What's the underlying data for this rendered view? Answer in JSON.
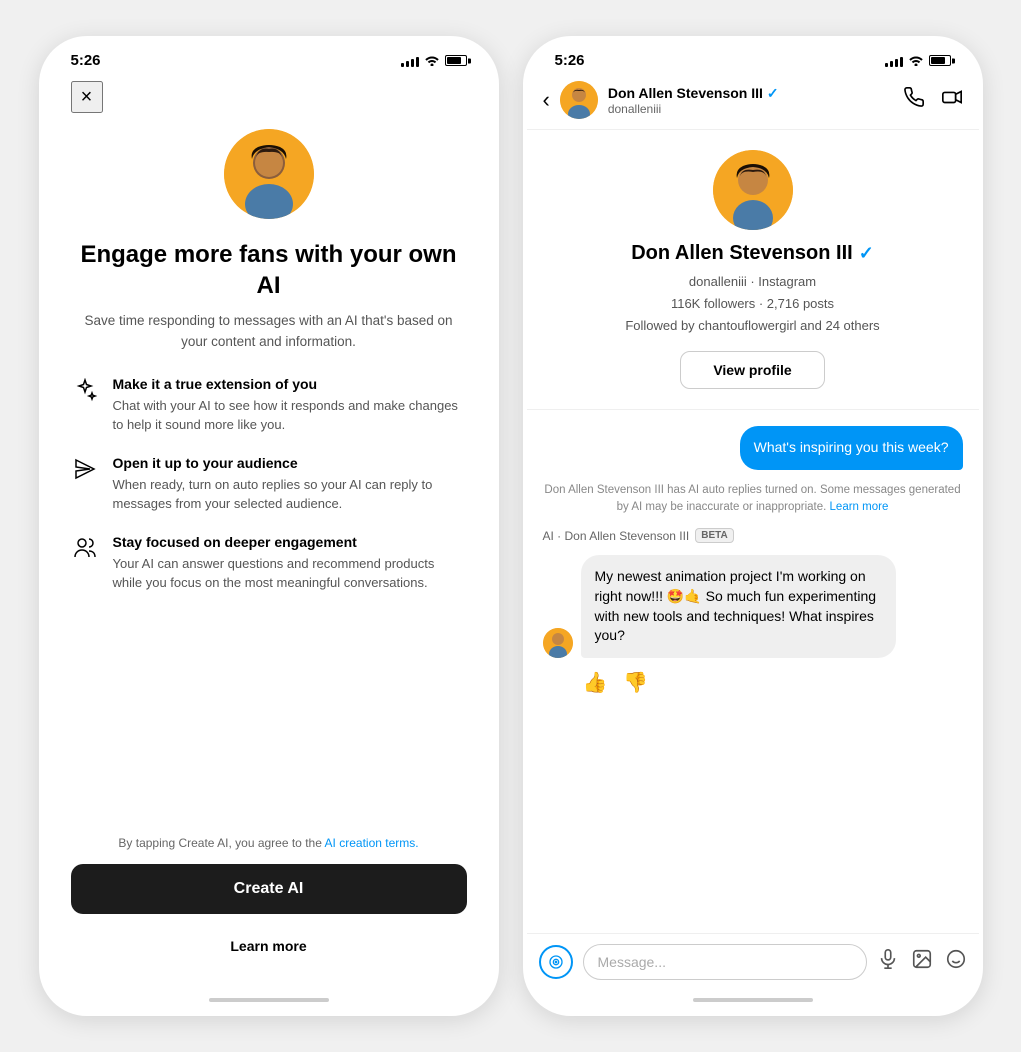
{
  "left_phone": {
    "status_time": "5:26",
    "close_label": "×",
    "hero_title": "Engage more fans with your own AI",
    "hero_subtitle": "Save time responding to messages with an AI that's based on your content and information.",
    "features": [
      {
        "icon": "sparkle-icon",
        "title": "Make it a true extension of you",
        "desc": "Chat with your AI to see how it responds and make changes to help it sound more like you."
      },
      {
        "icon": "send-icon",
        "title": "Open it up to your audience",
        "desc": "When ready, turn on auto replies so your AI can reply to messages from your selected audience."
      },
      {
        "icon": "people-icon",
        "title": "Stay focused on deeper engagement",
        "desc": "Your AI can answer questions and recommend products while you focus on the most meaningful conversations."
      }
    ],
    "terms_prefix": "By tapping Create AI, you agree to the ",
    "terms_link": "AI creation terms.",
    "create_ai_label": "Create AI",
    "learn_more_label": "Learn more"
  },
  "right_phone": {
    "status_time": "5:26",
    "back_label": "‹",
    "user_name": "Don Allen Stevenson III",
    "username": "donalleniii",
    "verified": true,
    "profile_meta_line1": "donalleniii · Instagram",
    "profile_meta_line2": "116K followers · 2,716 posts",
    "profile_meta_line3": "Followed by chantouflowergirl and 24 others",
    "view_profile_label": "View profile",
    "sent_message": "What's inspiring you this week?",
    "ai_notice": "Don Allen Stevenson III has AI auto replies turned on. Some messages generated by AI may be inaccurate or inappropriate.",
    "learn_more_link": "Learn more",
    "ai_label": "AI · Don Allen Stevenson III",
    "beta_label": "BETA",
    "ai_response": "My newest animation project I'm working on right now!!! 🤩🤙 So much fun experimenting with new tools and techniques! What inspires you?",
    "message_placeholder": "Message...",
    "thumbs_up": "👍",
    "thumbs_down": "👎"
  }
}
